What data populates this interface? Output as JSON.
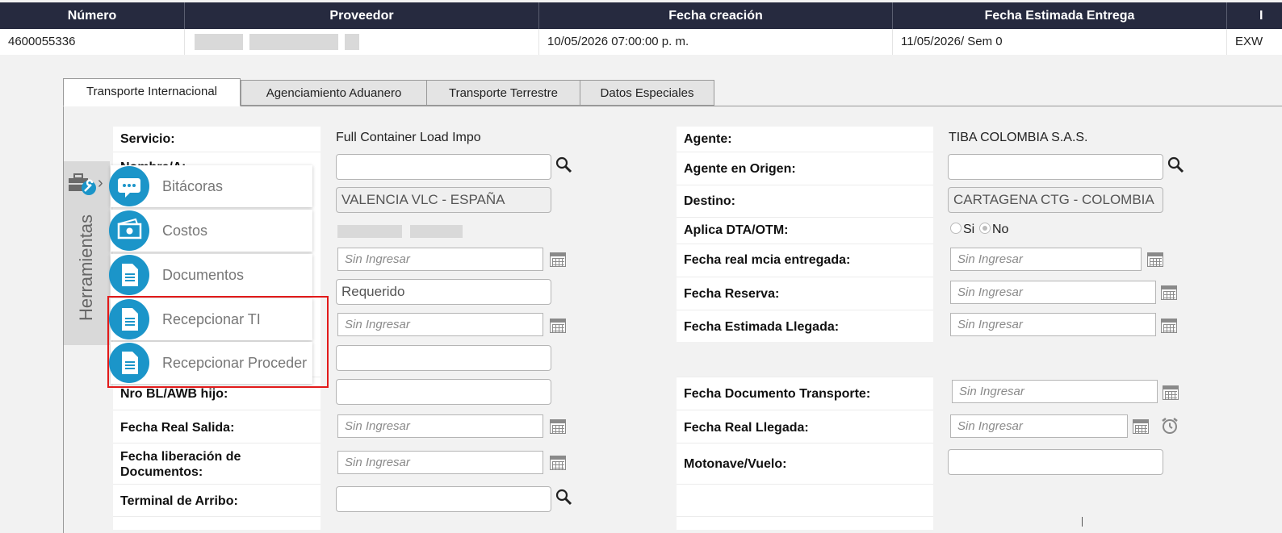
{
  "grid": {
    "headers": [
      "Número",
      "Proveedor",
      "Fecha creación",
      "Fecha Estimada Entrega",
      "I"
    ],
    "row": {
      "numero": "4600055336",
      "fecha_creacion": "10/05/2026 07:00:00 p. m.",
      "fecha_entrega": "11/05/2026/ Sem 0",
      "incoterm": "EXW"
    }
  },
  "tabs": [
    "Transporte Internacional",
    "Agenciamiento Aduanero",
    "Transporte Terrestre",
    "Datos Especiales"
  ],
  "left": {
    "servicio_label": "Servicio:",
    "servicio_value": "Full Container Load Impo",
    "nombre_label": "Nombre/Apellido",
    "origen_value": "VALENCIA VLC - ESPAÑA",
    "requerido_value": "Requerido",
    "bl_label": "Nro BL/AWB hijo:",
    "salida_label": "Fecha Real Salida:",
    "liberacion_label": "Fecha liberación de Documentos:",
    "terminal_label": "Terminal de Arribo:"
  },
  "right": {
    "agente_label": "Agente:",
    "agente_value": "TIBA COLOMBIA S.A.S.",
    "agente_origen_label": "Agente en Origen:",
    "destino_label": "Destino:",
    "destino_value": "CARTAGENA CTG - COLOMBIA",
    "dta_label": "Aplica DTA/OTM:",
    "si_label": "Si",
    "no_label": "No",
    "mcia_label": "Fecha real mcia entregada:",
    "reserva_label": "Fecha Reserva:",
    "est_llegada_label": "Fecha Estimada Llegada:",
    "doc_transporte_label": "Fecha Documento Transporte:",
    "real_llegada_label": "Fecha Real Llegada:",
    "motonave_label": "Motonave/Vuelo:"
  },
  "date_placeholder": "Sin Ingresar",
  "tools": {
    "title": "Herramientas",
    "items": [
      "Bitácoras",
      "Costos",
      "Documentos",
      "Recepcionar TI",
      "Recepcionar Proceder"
    ]
  },
  "colors": {
    "header_bg": "#262a3f",
    "accent": "#1b95c9",
    "highlight": "#e21a1a"
  }
}
